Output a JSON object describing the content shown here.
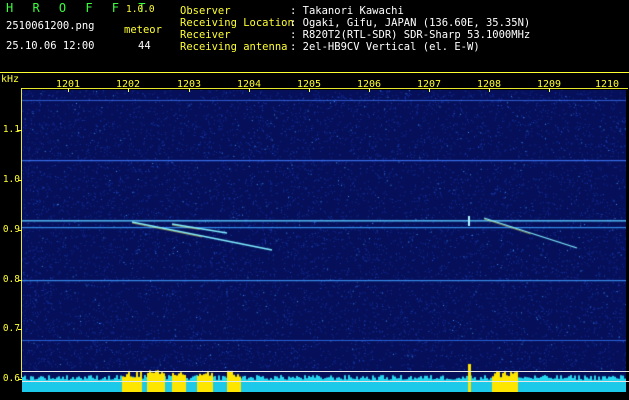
{
  "header": {
    "logo": "H R O F F T",
    "version": "1.0.0",
    "filename": "2510061200.png",
    "datetime": "25.10.06 12:00",
    "meteor_label": "meteor",
    "meteor_count": "44",
    "info": [
      {
        "key": "Observer",
        "value": ": Takanori Kawachi"
      },
      {
        "key": "Receiving Location",
        "value": ": Ogaki, Gifu, JAPAN (136.60E, 35.35N)"
      },
      {
        "key": "Receiver",
        "value": ": R820T2(RTL-SDR) SDR-Sharp 53.1000MHz"
      },
      {
        "key": "Receiving antenna",
        "value": ": 2el-HB9CV Vertical (el. E-W)"
      }
    ]
  },
  "axis": {
    "y_unit": "kHz",
    "x_ticks": [
      "1201",
      "1202",
      "1203",
      "1204",
      "1205",
      "1206",
      "1207",
      "1208",
      "1209",
      "1210"
    ],
    "y_ticks": [
      "1.1",
      "1.0",
      "0.9",
      "0.8",
      "0.7",
      "0.6"
    ]
  },
  "colors": {
    "background": "#000000",
    "spectrogram_bg": "#06105a",
    "label_yellow": "#ffff33",
    "label_green": "#3cff3c"
  }
}
